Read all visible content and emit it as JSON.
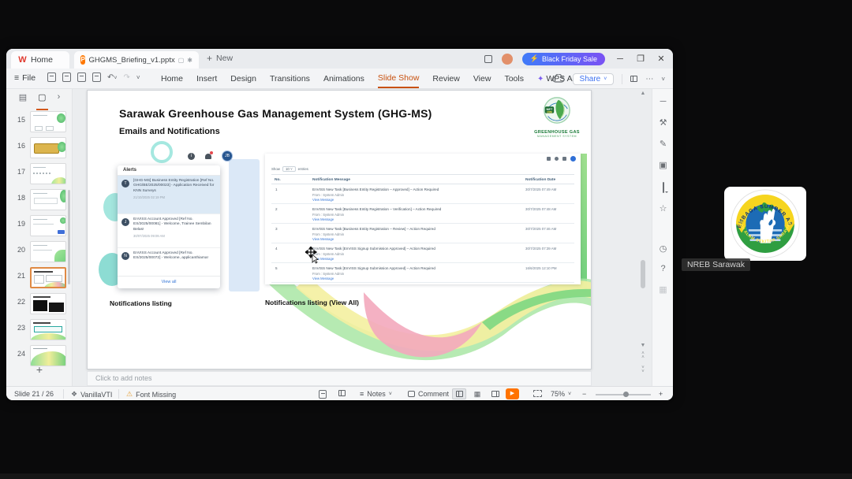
{
  "titlebar": {
    "home_tab": "Home",
    "doc_tab": "GHGMS_Briefing_v1.pptx",
    "new_label": "New",
    "promo_label": "Black Friday Sale"
  },
  "menubar": {
    "file": "File",
    "items": [
      "Home",
      "Insert",
      "Design",
      "Transitions",
      "Animations",
      "Slide Show",
      "Review",
      "View",
      "Tools"
    ],
    "wps_ai": "WPS AI",
    "share": "Share"
  },
  "slide_panel": {
    "slides": [
      {
        "num": "15"
      },
      {
        "num": "16"
      },
      {
        "num": "17"
      },
      {
        "num": "18"
      },
      {
        "num": "19"
      },
      {
        "num": "20"
      },
      {
        "num": "21"
      },
      {
        "num": "22"
      },
      {
        "num": "23"
      },
      {
        "num": "24"
      }
    ],
    "add_label": "+"
  },
  "slide": {
    "title": "Sarawak Greenhouse Gas Management System (GHG-MS)",
    "subtitle": "Emails and Notifications",
    "logo": {
      "net": "NET",
      "year": "2050",
      "line1": "GREENHOUSE GAS",
      "line2": "MANAGEMENT SYSTEM"
    },
    "alerts": {
      "header": "Alerts",
      "items": [
        {
          "initial": "T",
          "text": "[GHG-MS] Business Entity Registration [Ref No. GHG/BE/2025/00023] - Application Received for KNN Surveys",
          "time": "21/10/2025 02:19 PM"
        },
        {
          "initial": "J",
          "text": "EnVISS Account Approved [Ref No. ES/2025/00081] - Welcome, Trainee Sembilan Belas!",
          "time": "30/07/2025 09:09 AM"
        },
        {
          "initial": "N",
          "text": "EnVISS Account Approved [Ref No. ES/2025/00072] - Welcome, applicanthiama!",
          "time": ""
        }
      ],
      "view_all": "View all"
    },
    "table": {
      "show_label": "Show",
      "show_value": "10",
      "entries_label": "entries",
      "columns": [
        "No.",
        "Notification Message",
        "Notification Date"
      ],
      "rows": [
        {
          "no": "1",
          "message": "EnVISS New Task [Business Entity Registration – Approved] – Action Required",
          "from": "From : System Admin",
          "link": "View Message",
          "date": "30/7/2025 07:49 AM"
        },
        {
          "no": "2",
          "message": "EnVISS New Task [Business Entity Registration – Verification] – Action Required",
          "from": "From : System Admin",
          "link": "View Message",
          "date": "30/7/2025 07:48 AM"
        },
        {
          "no": "3",
          "message": "EnVISS New Task [Business Entity Registration – Review] – Action Required",
          "from": "From : System Admin",
          "link": "View Message",
          "date": "30/7/2025 07:46 AM"
        },
        {
          "no": "4",
          "message": "EnVISS New Task [EnVISS Signup Submission Approved] – Action Required",
          "from": "From : System Admin",
          "link": "View Message",
          "date": "30/7/2025 07:39 AM"
        },
        {
          "no": "5",
          "message": "EnVISS New Task [EnVISS Signup Submission Approved] – Action Required",
          "from": "From : System Admin",
          "link": "View Message",
          "date": "16/6/2025 12:10 PM"
        }
      ]
    },
    "captions": {
      "left": "Notifications listing",
      "right": "Notifications listing (View All)"
    }
  },
  "notes_placeholder": "Click to add notes",
  "statusbar": {
    "slide_info": "Slide 21 / 26",
    "theme": "VanillaVTI",
    "font_missing": "Font Missing",
    "notes": "Notes",
    "comment": "Comment",
    "zoom": "75%"
  },
  "participant": {
    "name": "NREB Sarawak",
    "logo_top": "LEMBAGA SUMBER ASLI",
    "logo_bottom": "DAN ALAM SEKITAR SARAWAK"
  }
}
